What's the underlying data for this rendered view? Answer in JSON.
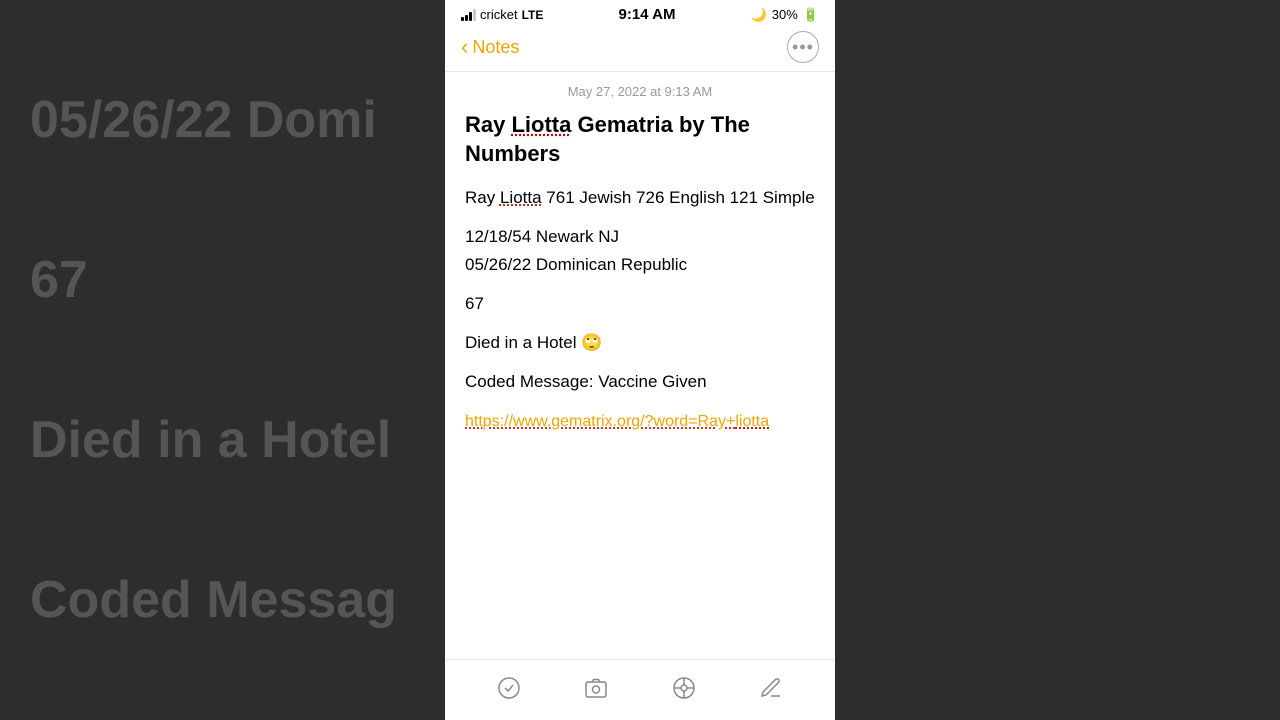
{
  "status_bar": {
    "carrier": "cricket",
    "network": "LTE",
    "time": "9:14 AM",
    "battery": "30%",
    "moon_icon": "🌙"
  },
  "nav": {
    "back_label": "Notes",
    "more_icon": "···"
  },
  "note": {
    "timestamp": "May 27, 2022 at 9:13 AM",
    "title": "Ray Liotta Gematria by The Numbers",
    "title_word1": "Ray",
    "title_word2": "Liotta",
    "title_word3": "Gematria by The Numbers",
    "body_line1": "Ray Liotta 761 Jewish 726 English 121 Simple",
    "body_line2": "12/18/54 Newark NJ",
    "body_line3": "05/26/22 Dominican Republic",
    "body_line4": "67",
    "body_line5": "Died in a Hotel 🙄",
    "body_line6": "Coded Message: Vaccine Given",
    "link": "https://www.gematrix.org/?word=Ray+liotta"
  },
  "toolbar": {
    "checklist_icon": "✓",
    "camera_icon": "⊙",
    "location_icon": "⊕",
    "compose_icon": "✎"
  },
  "background": {
    "lines": [
      "05/26/22 Domi",
      "67",
      "Died in a Hotel",
      "Coded Messag"
    ]
  }
}
